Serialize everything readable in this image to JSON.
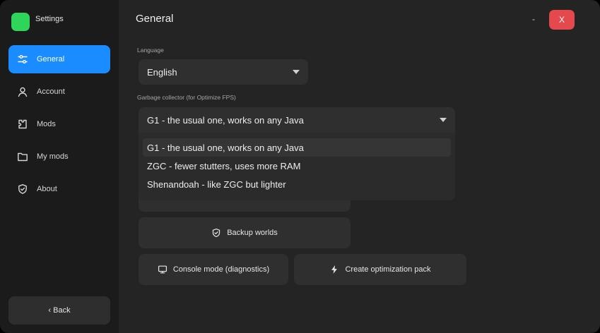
{
  "app": {
    "title": "Settings",
    "logo_color": "#2fd45a"
  },
  "sidebar": {
    "items": [
      {
        "label": "General",
        "icon": "sliders-icon",
        "active": true
      },
      {
        "label": "Account",
        "icon": "user-icon",
        "active": false
      },
      {
        "label": "Mods",
        "icon": "puzzle-icon",
        "active": false
      },
      {
        "label": "My mods",
        "icon": "folder-icon",
        "active": false
      },
      {
        "label": "About",
        "icon": "shield-check-icon",
        "active": false
      }
    ],
    "back_label": "‹ Back"
  },
  "header": {
    "title": "General",
    "minimize_label": "-",
    "close_label": "X"
  },
  "language": {
    "label": "Language",
    "value": "English"
  },
  "gc": {
    "label": "Garbage collector (for Optimize FPS)",
    "value": "G1  -  the usual one, works on any Java",
    "options": [
      "G1  -  the usual one, works on any Java",
      "ZGC  -  fewer stutters, uses more RAM",
      "Shenandoah  -  like ZGC but lighter"
    ]
  },
  "buttons": {
    "backup": "Backup worlds",
    "console": "Console mode (diagnostics)",
    "create_pack": "Create optimization pack"
  },
  "colors": {
    "accent": "#1a8cff",
    "danger": "#e5484d",
    "bg": "#242424",
    "sidebar": "#1b1b1b"
  }
}
